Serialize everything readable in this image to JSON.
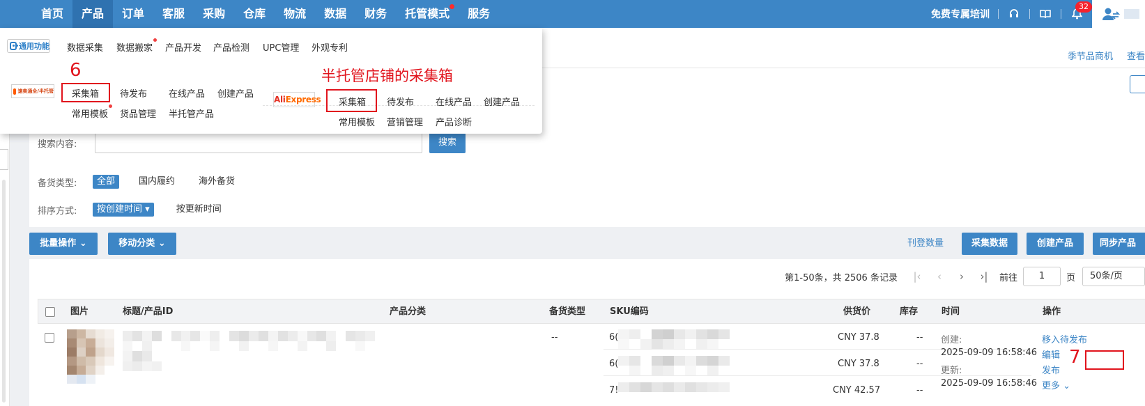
{
  "nav": {
    "menu": [
      {
        "label": "首页"
      },
      {
        "label": "产品",
        "active": true
      },
      {
        "label": "订单"
      },
      {
        "label": "客服"
      },
      {
        "label": "采购"
      },
      {
        "label": "仓库"
      },
      {
        "label": "物流"
      },
      {
        "label": "数据"
      },
      {
        "label": "财务"
      },
      {
        "label": "托管模式",
        "dot": true
      },
      {
        "label": "服务"
      }
    ],
    "training": "免费专属培训",
    "notification_count": "32",
    "accent_color": "#3d86c6"
  },
  "subbar": {
    "link_seasonal": "季节品商机",
    "link_view": "查看"
  },
  "dropdown": {
    "general_logo": "通用功能",
    "general_items": [
      "数据采集",
      "数据搬家",
      "产品开发",
      "产品检测",
      "UPC管理",
      "外观专利"
    ],
    "temu_logo": "速卖通全/半托管",
    "temu_row1": [
      "采集箱",
      "待发布",
      "在线产品",
      "创建产品"
    ],
    "temu_row2": [
      "常用模板",
      "货品管理",
      "半托管产品"
    ],
    "ali_logo_a": "Ali",
    "ali_logo_b": "Express",
    "ali_row1": [
      "采集箱",
      "待发布",
      "在线产品",
      "创建产品"
    ],
    "ali_row2": [
      "常用模板",
      "营销管理",
      "产品诊断"
    ]
  },
  "annotations": {
    "step6": "6",
    "half_hosted_label": "半托管店铺的采集箱",
    "step7": "7"
  },
  "filters": {
    "search_label": "搜索内容:",
    "search_button": "搜索",
    "stock_label": "备货类型:",
    "stock_options": [
      "全部",
      "国内履约",
      "海外备货"
    ],
    "sort_label": "排序方式:",
    "sort_selected": "按创建时间",
    "sort_other": "按更新时间"
  },
  "actions": {
    "batch": "批量操作",
    "move_category": "移动分类",
    "listing_count": "刊登数量",
    "collect_data": "采集数据",
    "create_product": "创建产品",
    "sync_product": "同步产品"
  },
  "pagination": {
    "summary": "第1-50条，共 2506 条记录",
    "goto_label": "前往",
    "page": "1",
    "page_unit": "页",
    "page_size": "50条/页"
  },
  "table": {
    "headers": {
      "image": "图片",
      "title": "标题/产品ID",
      "category": "产品分类",
      "stock_type": "备货类型",
      "sku": "SKU编码",
      "price": "供货价",
      "inventory": "库存",
      "time": "时间",
      "ops": "操作"
    },
    "row": {
      "stock_type": "--",
      "sku_prefix": [
        "6(",
        "6(",
        "7!"
      ],
      "prices": [
        "CNY 37.8",
        "CNY 37.8",
        "CNY 42.57"
      ],
      "inventory": [
        "--",
        "--",
        "--"
      ],
      "created_label": "创建:",
      "created_time": "2025-09-09 16:58:46",
      "updated_label": "更新:",
      "updated_time": "2025-09-09 16:58:46",
      "ops": {
        "move": "移入待发布",
        "edit": "编辑",
        "publish": "发布",
        "more": "更多"
      }
    }
  }
}
